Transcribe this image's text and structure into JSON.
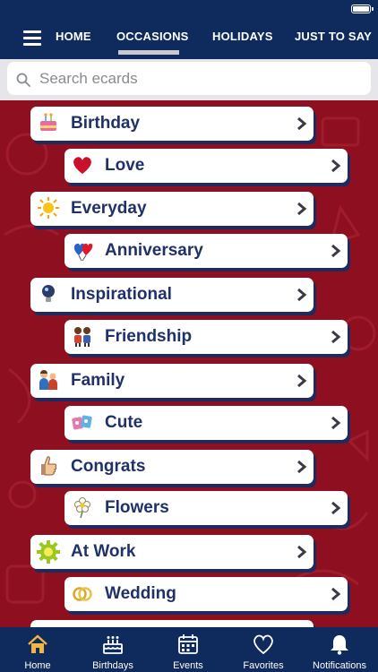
{
  "nav": {
    "tabs": [
      "HOME",
      "OCCASIONS",
      "HOLIDAYS",
      "JUST TO SAY"
    ],
    "active_tab": "OCCASIONS"
  },
  "search": {
    "placeholder": "Search ecards",
    "value": ""
  },
  "categories": [
    {
      "label": "Birthday",
      "icon": "cake-icon"
    },
    {
      "label": "Love",
      "icon": "heart-icon"
    },
    {
      "label": "Everyday",
      "icon": "sun-icon"
    },
    {
      "label": "Anniversary",
      "icon": "balloons-icon"
    },
    {
      "label": "Inspirational",
      "icon": "lightbulb-icon"
    },
    {
      "label": "Friendship",
      "icon": "friends-icon"
    },
    {
      "label": "Family",
      "icon": "family-icon"
    },
    {
      "label": "Cute",
      "icon": "cute-icon"
    },
    {
      "label": "Congrats",
      "icon": "thumbs-up-icon"
    },
    {
      "label": "Flowers",
      "icon": "flower-icon"
    },
    {
      "label": "At Work",
      "icon": "gear-icon"
    },
    {
      "label": "Wedding",
      "icon": "rings-icon"
    }
  ],
  "bottom_tabs": [
    {
      "label": "Home",
      "icon": "home-icon",
      "active": true
    },
    {
      "label": "Birthdays",
      "icon": "cake-icon"
    },
    {
      "label": "Events",
      "icon": "calendar-icon"
    },
    {
      "label": "Favorites",
      "icon": "heart-icon"
    },
    {
      "label": "Notifications",
      "icon": "bell-icon"
    }
  ],
  "colors": {
    "header": "#0f2a5c",
    "background": "#8e0f1f",
    "card_text": "#1f3169",
    "card_shadow": "#1f2b5f",
    "active_tab_icon": "#f3b640"
  }
}
